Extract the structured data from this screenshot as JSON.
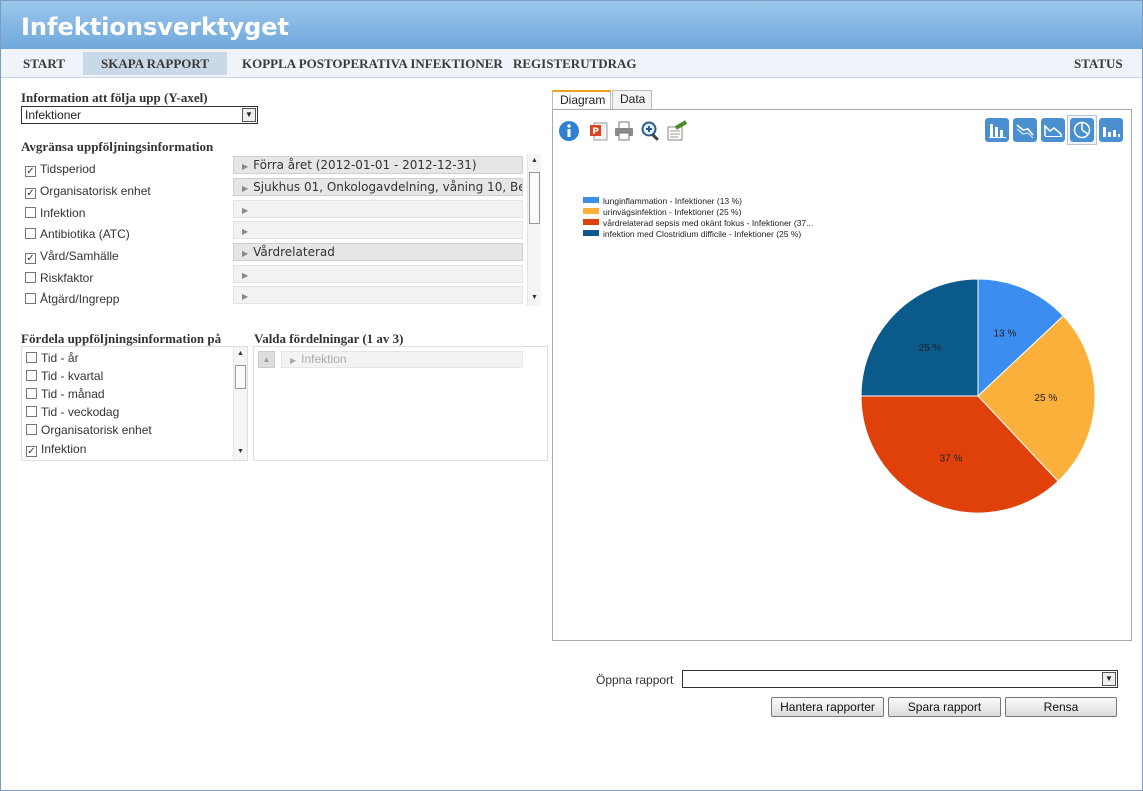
{
  "app": {
    "title": "Infektionsverktyget"
  },
  "nav": {
    "start": "START",
    "skapa": "SKAPA RAPPORT",
    "koppla": "KOPPLA POSTOPERATIVA INFEKTIONER",
    "register": "REGISTERUTDRAG",
    "status": "STATUS"
  },
  "yaxis": {
    "label": "Information att följa upp (Y-axel)",
    "value": "Infektioner"
  },
  "limit": {
    "label": "Avgränsa uppföljningsinformation",
    "items": [
      {
        "label": "Tidsperiod",
        "checked": true,
        "filter": "Förra året (2012-01-01 - 2012-12-31)"
      },
      {
        "label": "Organisatorisk enhet",
        "checked": true,
        "filter": "Sjukhus 01, Onkologavdelning, våning 10, Berg"
      },
      {
        "label": "Infektion",
        "checked": false,
        "filter": ""
      },
      {
        "label": "Antibiotika (ATC)",
        "checked": false,
        "filter": ""
      },
      {
        "label": "Vård/Samhälle",
        "checked": true,
        "filter": "Vårdrelaterad"
      },
      {
        "label": "Riskfaktor",
        "checked": false,
        "filter": ""
      },
      {
        "label": "Åtgärd/Ingrepp",
        "checked": false,
        "filter": ""
      }
    ]
  },
  "distribute": {
    "label": "Fördela uppföljningsinformation på",
    "items": [
      {
        "label": "Tid - år",
        "checked": false
      },
      {
        "label": "Tid - kvartal",
        "checked": false
      },
      {
        "label": "Tid - månad",
        "checked": false
      },
      {
        "label": "Tid - veckodag",
        "checked": false
      },
      {
        "label": "Organisatorisk enhet",
        "checked": false
      },
      {
        "label": "Infektion",
        "checked": true
      }
    ]
  },
  "selected": {
    "label": "Valda fördelningar (1 av 3)",
    "items": [
      "Infektion"
    ]
  },
  "tabs": {
    "diagram": "Diagram",
    "data": "Data"
  },
  "icons": {
    "toolbar": [
      "info-icon",
      "powerpoint-icon",
      "print-icon",
      "zoom-in-icon",
      "edit-icon"
    ],
    "chart_types": [
      "bar-chart-icon",
      "line-chart-icon",
      "area-chart-icon",
      "pie-chart-icon",
      "column-chart-icon"
    ]
  },
  "chart_data": {
    "type": "pie",
    "series": [
      {
        "name": "lunginflammation - Infektioner (13 %)",
        "value": 13,
        "label": "13 %",
        "color": "#3b8ef0"
      },
      {
        "name": "urinvägsinfektion - Infektioner (25 %)",
        "value": 25,
        "label": "25 %",
        "color": "#fbb03b"
      },
      {
        "name": "vårdrelaterad sepsis med okänt fokus - Infektioner (37...",
        "value": 37,
        "label": "37 %",
        "color": "#e0400a"
      },
      {
        "name": "infektion med Clostridium difficile - Infektioner (25 %)",
        "value": 25,
        "label": "25 %",
        "color": "#0a5a8c"
      }
    ]
  },
  "report": {
    "open_label": "Öppna rapport",
    "open_value": "",
    "manage": "Hantera rapporter",
    "save": "Spara rapport",
    "clear": "Rensa"
  },
  "colors": {
    "header": "#6fa8dc",
    "nav_active": "#c9d9e8"
  }
}
